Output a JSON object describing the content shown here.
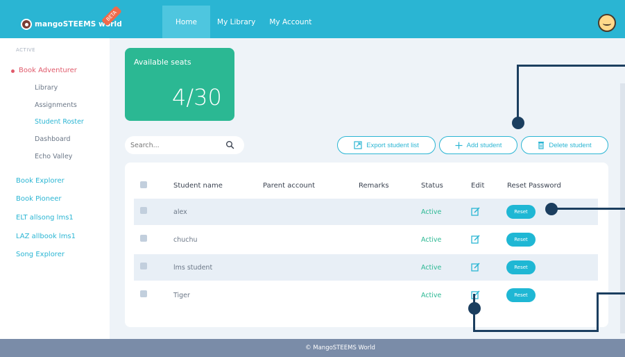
{
  "header": {
    "logo_text": "mangoSTEEMS world",
    "beta_badge": "BETA",
    "nav": [
      "Home",
      "My Library",
      "My Account"
    ]
  },
  "sidebar": {
    "section_label": "ACTIVE",
    "active_course": "Book Adventurer",
    "sub_items": [
      "Library",
      "Assignments",
      "Student Roster",
      "Dashboard",
      "Echo Valley"
    ],
    "active_sub": "Student Roster",
    "other_courses": [
      "Book Explorer",
      "Book Pioneer",
      "ELT allsong lms1",
      "LAZ allbook lms1",
      "Song Explorer"
    ]
  },
  "seats": {
    "label": "Available seats",
    "value": "4/30"
  },
  "search": {
    "placeholder": "Search..."
  },
  "buttons": {
    "export": "Export student list",
    "add": "Add student",
    "delete": "Delete student"
  },
  "table": {
    "headers": [
      "Student name",
      "Parent account",
      "Remarks",
      "Status",
      "Edit",
      "Reset Password"
    ],
    "rows": [
      {
        "name": "alex",
        "parent": "",
        "remarks": "",
        "status": "Active",
        "reset": "Reset"
      },
      {
        "name": "chuchu",
        "parent": "",
        "remarks": "",
        "status": "Active",
        "reset": "Reset"
      },
      {
        "name": "lms student",
        "parent": "",
        "remarks": "",
        "status": "Active",
        "reset": "Reset"
      },
      {
        "name": "Tiger",
        "parent": "",
        "remarks": "",
        "status": "Active",
        "reset": "Reset"
      }
    ]
  },
  "footer": {
    "text": "© MangoSTEEMS World"
  },
  "colors": {
    "header": "#2ab5d3",
    "seats_card": "#2bb893",
    "accent_red": "#e05a6b",
    "footer": "#7a8ca8",
    "callout": "#1b3e5f"
  }
}
